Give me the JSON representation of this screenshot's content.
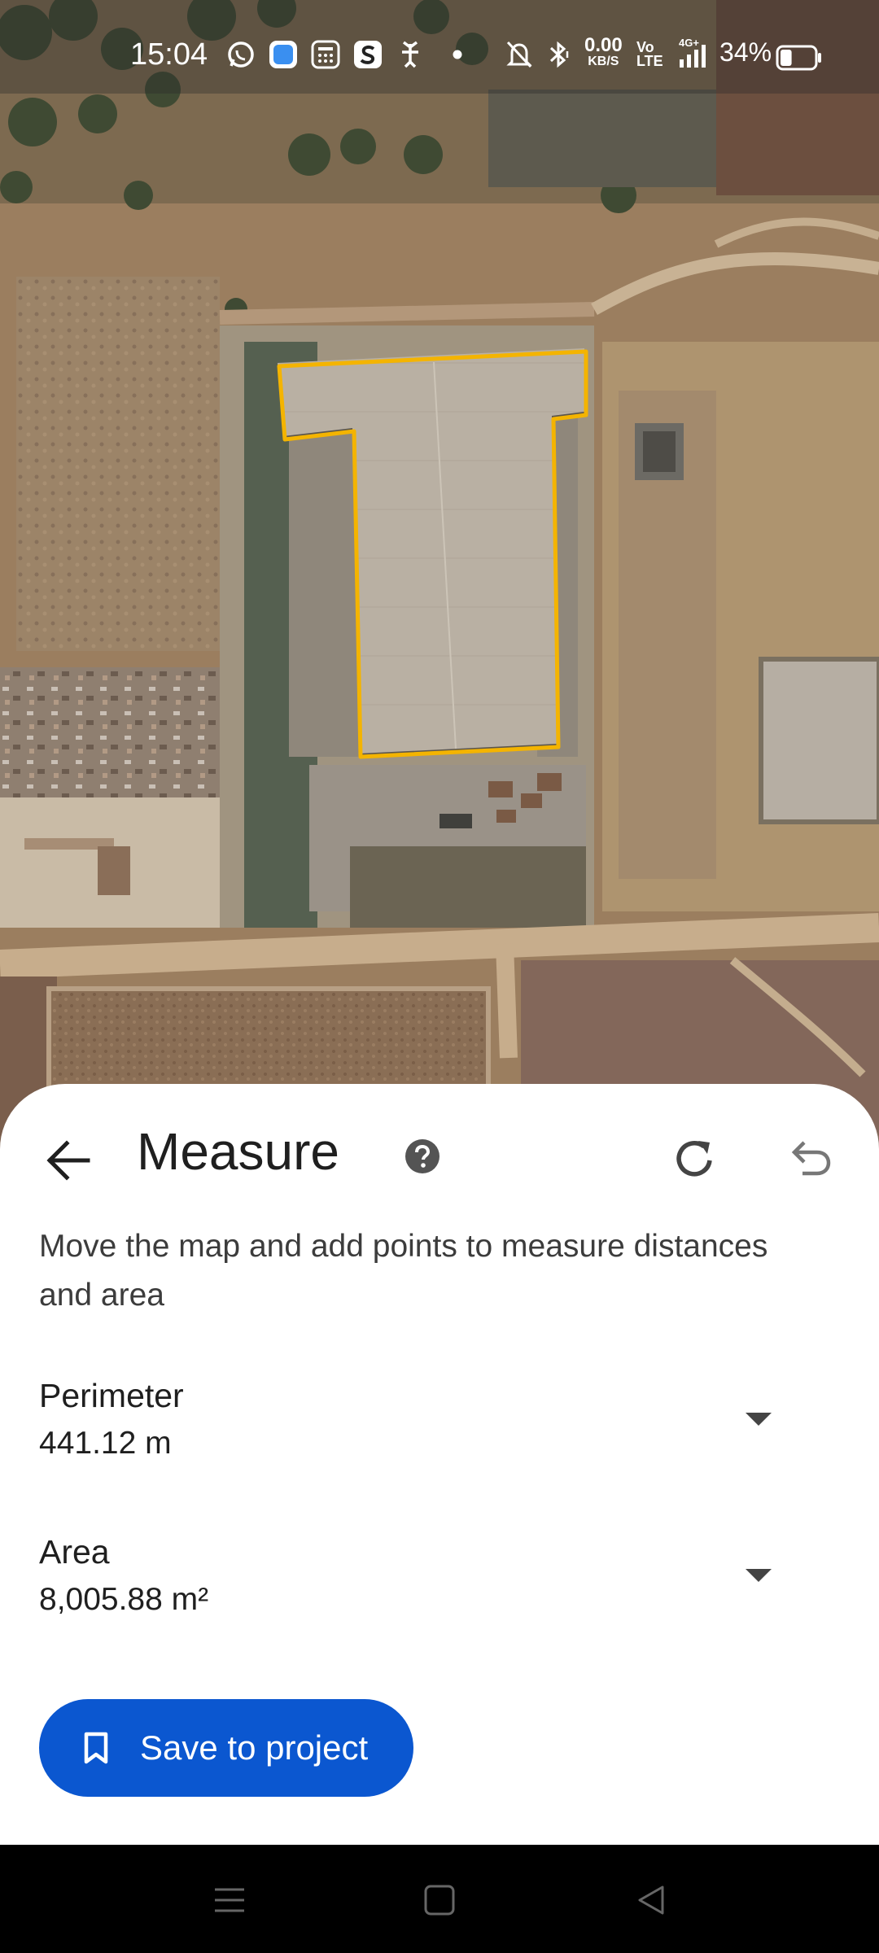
{
  "status_bar": {
    "time": "15:04",
    "net_speed_value": "0.00",
    "net_speed_unit": "KB/S",
    "volte_top": "Vo",
    "volte_bottom": "LTE",
    "signal_label": "4G+",
    "battery_percent": "34%",
    "battery_level": 0.34,
    "icons": [
      "whatsapp-icon",
      "app-icon",
      "calculator-icon",
      "s-app-icon",
      "fan-icon",
      "dot-icon",
      "mute-bell-icon",
      "bluetooth-icon",
      "signal-icon",
      "battery-icon"
    ]
  },
  "map": {
    "outline_color": "#f4b400",
    "description": "satellite"
  },
  "sheet": {
    "title": "Measure",
    "instructions": "Move the map and add points to measure distances and area",
    "perimeter": {
      "label": "Perimeter",
      "value": "441.12 m"
    },
    "area": {
      "label": "Area",
      "value": "8,005.88 m²"
    },
    "save_label": "Save to project",
    "accent": "#0b57d0"
  },
  "nav": {
    "buttons": [
      "menu-icon",
      "home-icon",
      "back-triangle-icon"
    ]
  }
}
